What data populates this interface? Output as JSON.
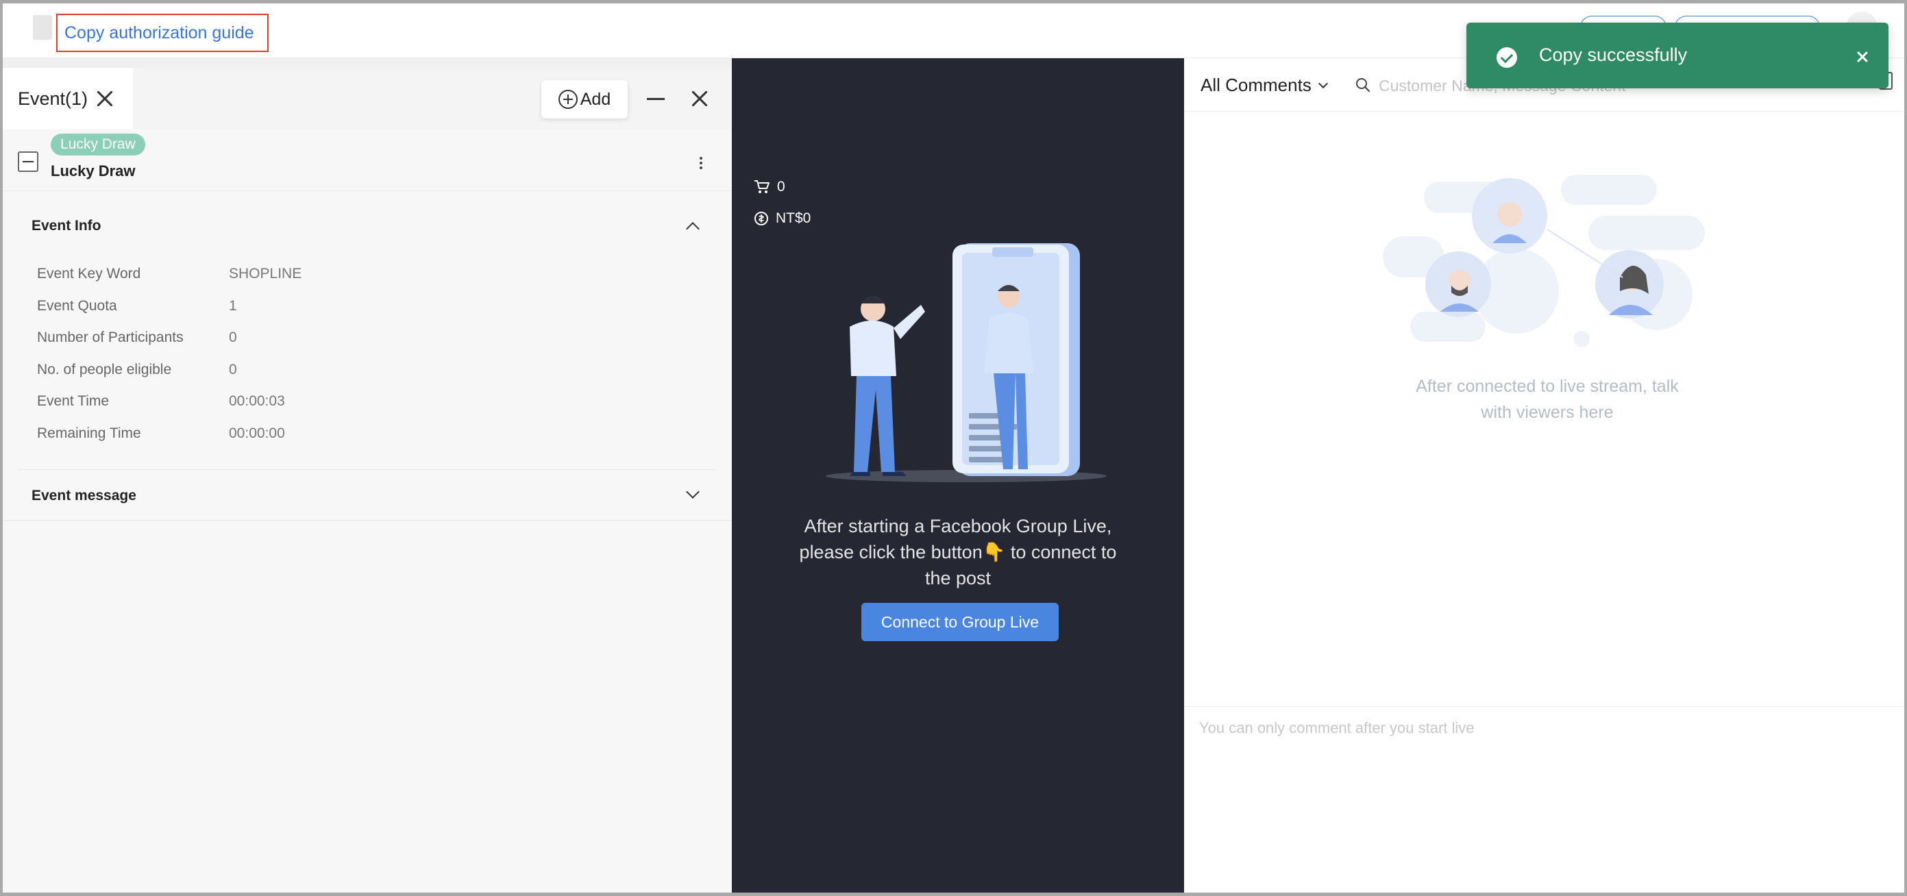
{
  "topbar": {
    "copy_guide_label": "Copy authorization guide"
  },
  "event_panel": {
    "tab_label": "Event(1)",
    "add_label": "Add",
    "badge": "Lucky Draw",
    "event_name": "Lucky Draw",
    "info_section_title": "Event Info",
    "message_section_title": "Event message",
    "info": [
      {
        "key": "Event Key Word",
        "value": "SHOPLINE"
      },
      {
        "key": "Event Quota",
        "value": "1"
      },
      {
        "key": "Number of Participants",
        "value": "0"
      },
      {
        "key": "No. of people eligible",
        "value": "0"
      },
      {
        "key": "Event Time",
        "value": "00:00:03"
      },
      {
        "key": "Remaining Time",
        "value": "00:00:00"
      }
    ]
  },
  "live_panel": {
    "cart_count": "0",
    "revenue": "NT$0",
    "instruction_line1": "After starting a Facebook Group Live,",
    "instruction_line2": "please click the button👇 to connect to",
    "instruction_line3": "the post",
    "connect_label": "Connect to Group Live"
  },
  "comments_panel": {
    "filter_label": "All Comments",
    "search_placeholder": "Customer Name, Message Content",
    "empty_line1": "After connected to live stream, talk",
    "empty_line2": "with viewers here",
    "input_placeholder": "You can only comment after you start live"
  },
  "toast": {
    "message": "Copy successfully"
  },
  "colors": {
    "accent_blue": "#4a86e0",
    "success_green": "#2e8b65",
    "badge_green": "#8ccfb8",
    "dark_panel": "#252833",
    "highlight_red": "#e03b2f"
  }
}
